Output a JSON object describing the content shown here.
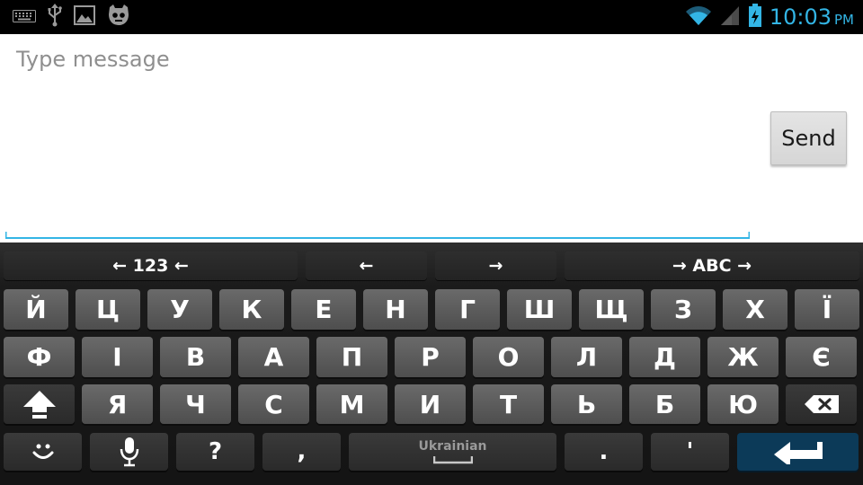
{
  "statusbar": {
    "left_icons": [
      "keyboard-icon",
      "usb-icon",
      "image-icon",
      "cyanogenmod-icon"
    ],
    "right_icons": [
      "wifi-icon",
      "signal-icon",
      "battery-charging-icon"
    ],
    "clock": {
      "time": "10:03",
      "ampm": "PM"
    },
    "accent_color": "#33b5e5"
  },
  "compose": {
    "placeholder": "Type message",
    "value": "",
    "send_label": "Send"
  },
  "keyboard": {
    "nav_row": [
      "← 123 ←",
      "←",
      "→",
      "→ ABC →"
    ],
    "row1": [
      "Й",
      "Ц",
      "У",
      "К",
      "Е",
      "Н",
      "Г",
      "Ш",
      "Щ",
      "З",
      "Х",
      "Ї"
    ],
    "row2": [
      "Ф",
      "І",
      "В",
      "А",
      "П",
      "Р",
      "О",
      "Л",
      "Д",
      "Ж",
      "Є"
    ],
    "row3": [
      "Я",
      "Ч",
      "С",
      "М",
      "И",
      "Т",
      "Ь",
      "Б",
      "Ю"
    ],
    "row4": {
      "question": "?",
      "comma": ",",
      "space_label": "Ukrainian",
      "period": ".",
      "apostrophe": "'"
    },
    "enter_color": "#0c3a58"
  }
}
